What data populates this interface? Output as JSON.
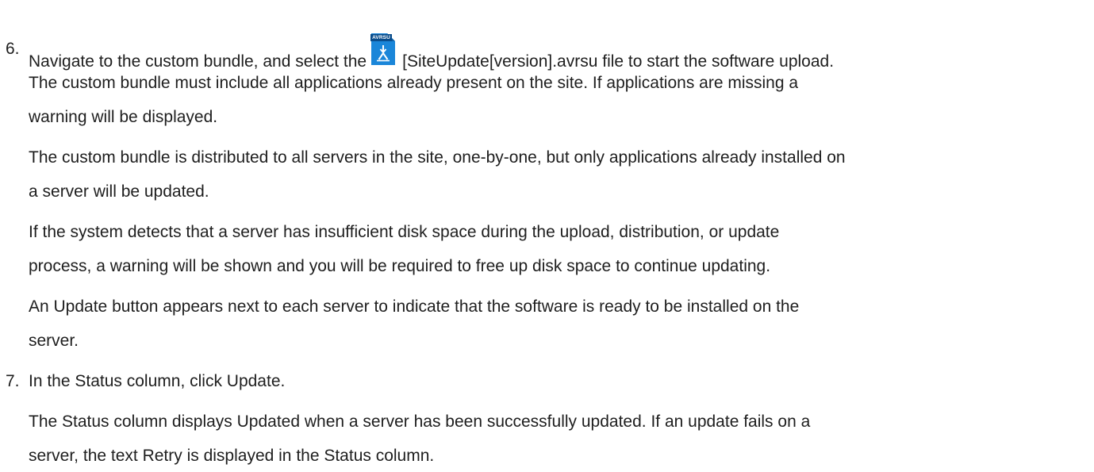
{
  "steps": [
    {
      "number": "6.",
      "first_line": {
        "before_icon": "Navigate to the custom bundle, and select the",
        "after_icon": "[SiteUpdate[version].avrsu file to start the software upload."
      },
      "lines": [
        "The custom bundle must include all applications already present on the site. If applications are missing a",
        "warning will be displayed.",
        "The custom bundle is distributed to all servers in the site, one-by-one, but only applications already installed on",
        "a server will be updated.",
        "If the system detects that a server has insufficient disk space during the upload, distribution, or update",
        "process, a warning will be shown and you will be required to free up disk space to continue updating.",
        "An Update button appears next to each server to indicate that the software is ready to be installed on the",
        "server."
      ]
    },
    {
      "number": "7.",
      "first_line": "In the Status column, click Update.",
      "lines": [
        "The Status column displays Updated when a server has been successfully updated. If an update fails on a",
        "server, the text Retry is displayed in the Status column."
      ]
    }
  ],
  "file_icon": {
    "label": "AVRSU",
    "name": "avrsu-file-icon",
    "color": "#1a86d9"
  }
}
